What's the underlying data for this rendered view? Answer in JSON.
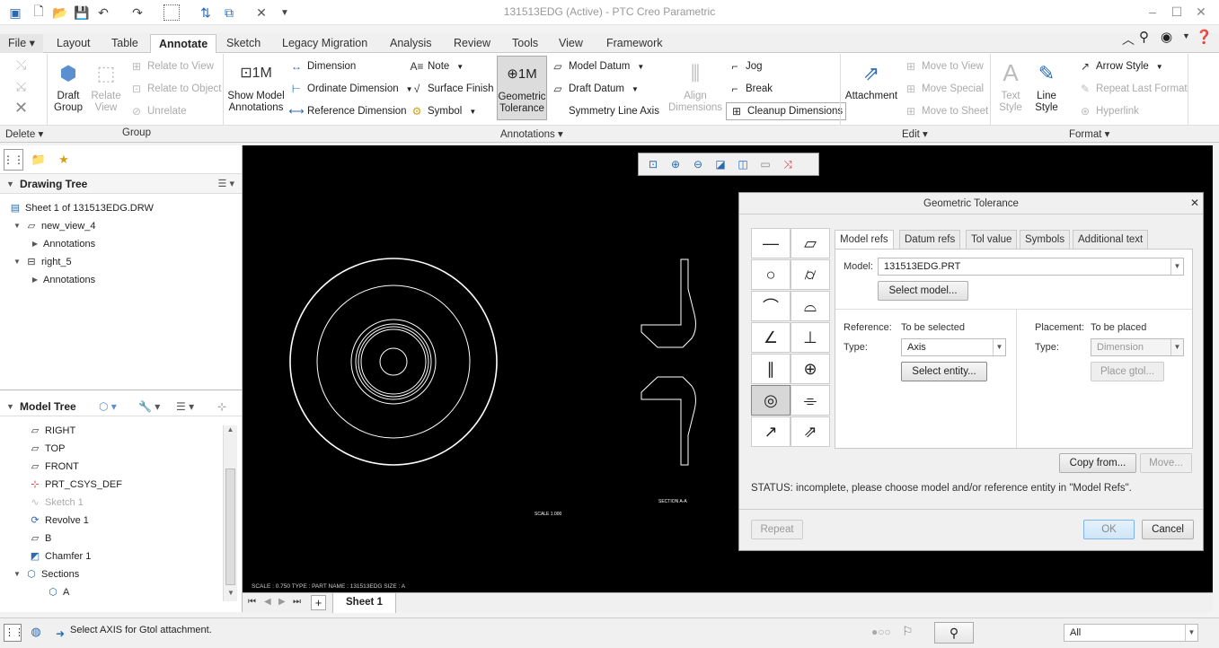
{
  "window": {
    "title": "131513EDG (Active) - PTC Creo Parametric"
  },
  "quick_access": [
    "new-icon",
    "open-icon",
    "save-icon",
    "undo-icon",
    "redo-icon",
    "select-box-icon",
    "regenerate-icon",
    "windows-icon",
    "close-window-icon",
    "customize-icon"
  ],
  "tabs": {
    "file": "File",
    "items": [
      "Layout",
      "Table",
      "Annotate",
      "Sketch",
      "Legacy Migration",
      "Analysis",
      "Review",
      "Tools",
      "View",
      "Framework"
    ],
    "active": "Annotate"
  },
  "ribbon": {
    "delete_group": "Delete",
    "group_group": "Group",
    "draft_group": "Draft\nGroup",
    "relate_view": "Relate\nView",
    "relate_to_view": "Relate to View",
    "relate_to_object": "Relate to Object",
    "unrelate": "Unrelate",
    "show_model_annotations": "Show Model\nAnnotations",
    "dimension": "Dimension",
    "ordinate_dimension": "Ordinate Dimension",
    "reference_dimension": "Reference Dimension",
    "note": "Note",
    "surface_finish": "Surface Finish",
    "symbol": "Symbol",
    "geometric_tolerance": "Geometric\nTolerance",
    "model_datum": "Model Datum",
    "draft_datum": "Draft Datum",
    "symmetry_line_axis": "Symmetry Line Axis",
    "align_dimensions": "Align\nDimensions",
    "jog": "Jog",
    "break": "Break",
    "cleanup_dimensions": "Cleanup Dimensions",
    "annotations_group": "Annotations",
    "attachment": "Attachment",
    "move_to_view": "Move to View",
    "move_special": "Move Special",
    "move_to_sheet": "Move to Sheet",
    "edit_group": "Edit",
    "text_style": "Text\nStyle",
    "line_style": "Line\nStyle",
    "arrow_style": "Arrow Style",
    "repeat_last_format": "Repeat Last Format",
    "hyperlink": "Hyperlink",
    "format_group": "Format"
  },
  "drawing_tree": {
    "title": "Drawing Tree",
    "items": [
      {
        "label": "Sheet 1 of 131513EDG.DRW",
        "level": 0
      },
      {
        "label": "new_view_4",
        "level": 1
      },
      {
        "label": "Annotations",
        "level": 2
      },
      {
        "label": "right_5",
        "level": 1
      },
      {
        "label": "Annotations",
        "level": 2
      }
    ]
  },
  "model_tree": {
    "title": "Model Tree",
    "items": [
      {
        "label": "RIGHT",
        "icon": "datum-plane-icon",
        "disabled": false
      },
      {
        "label": "TOP",
        "icon": "datum-plane-icon",
        "disabled": false
      },
      {
        "label": "FRONT",
        "icon": "datum-plane-icon",
        "disabled": false
      },
      {
        "label": "PRT_CSYS_DEF",
        "icon": "csys-icon",
        "disabled": false
      },
      {
        "label": "Sketch 1",
        "icon": "sketch-icon",
        "disabled": true
      },
      {
        "label": "Revolve 1",
        "icon": "revolve-icon",
        "disabled": false
      },
      {
        "label": "B",
        "icon": "datum-plane-icon",
        "disabled": false
      },
      {
        "label": "Chamfer 1",
        "icon": "chamfer-icon",
        "disabled": false
      },
      {
        "label": "Sections",
        "icon": "sections-icon",
        "disabled": false
      },
      {
        "label": "A",
        "icon": "section-icon",
        "disabled": false
      }
    ]
  },
  "canvas": {
    "scale_label": "SCALE  1.000",
    "section_label": "SECTION  A-A",
    "footer": "SCALE : 0.750     TYPE : PART     NAME : 131513EDG     SIZE : A"
  },
  "sheet": {
    "tab": "Sheet 1"
  },
  "status": {
    "message": "Select AXIS for Gtol attachment.",
    "filter": "All"
  },
  "dialog": {
    "title": "Geometric Tolerance",
    "tabs": [
      "Model refs",
      "Datum refs",
      "Tol value",
      "Symbols",
      "Additional text"
    ],
    "active_tab": "Model refs",
    "model_label": "Model:",
    "model_value": "131513EDG.PRT",
    "select_model": "Select model...",
    "reference_label": "Reference:",
    "reference_value": "To be selected",
    "type_label": "Type:",
    "type_value": "Axis",
    "select_entity": "Select entity...",
    "placement_label": "Placement:",
    "placement_value": "To be placed",
    "placement_type_label": "Type:",
    "placement_type_value": "Dimension",
    "place_gtol": "Place gtol...",
    "copy_from": "Copy from...",
    "move": "Move...",
    "status": "STATUS: incomplete, please choose model and/or reference entity in \"Model Refs\".",
    "repeat": "Repeat",
    "ok": "OK",
    "cancel": "Cancel",
    "symbols": [
      "straightness",
      "flatness",
      "circularity",
      "cylindricity",
      "profile-of-line",
      "profile-of-surface",
      "angularity",
      "perpendicularity",
      "parallelism",
      "position",
      "concentricity",
      "symmetry",
      "circular-runout",
      "total-runout"
    ],
    "selected_symbol": "concentricity"
  }
}
